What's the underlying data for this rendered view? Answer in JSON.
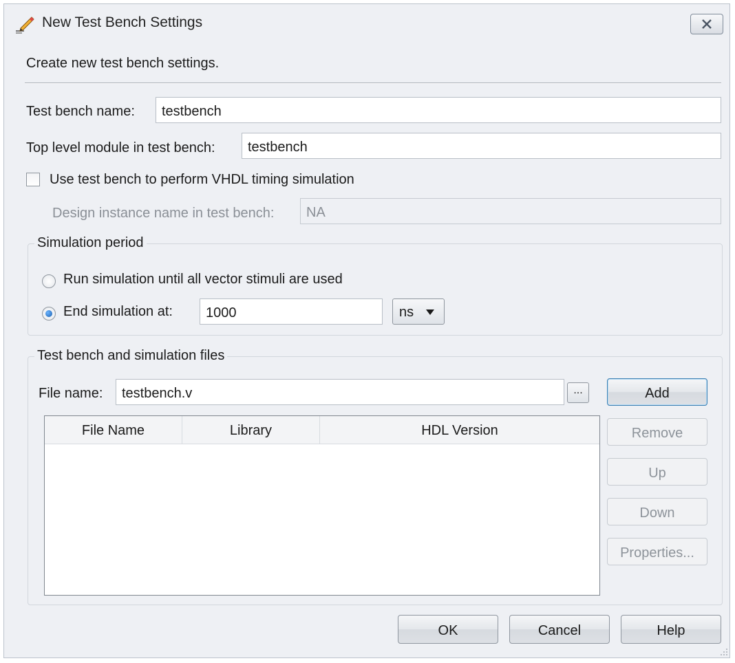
{
  "window": {
    "title": "New Test Bench Settings",
    "close_icon": "close-icon"
  },
  "intro": "Create new test bench settings.",
  "test_bench_name": {
    "label": "Test bench name:",
    "value": "testbench"
  },
  "top_level_module": {
    "label": "Top level module in test bench:",
    "value": "testbench"
  },
  "vhdl_timing": {
    "label": "Use test bench to perform VHDL timing simulation",
    "checked": false
  },
  "design_instance": {
    "label": "Design instance name in test bench:",
    "value": "NA"
  },
  "simulation_period": {
    "title": "Simulation period",
    "run_until_label": "Run simulation until all vector stimuli are used",
    "end_at_label": "End simulation at:",
    "end_at_value": "1000",
    "unit": "ns",
    "selected": "end_at"
  },
  "files_group": {
    "title": "Test bench and simulation files",
    "file_name_label": "File name:",
    "file_name_value": "testbench.v",
    "browse_label": "...",
    "columns": [
      "File Name",
      "Library",
      "HDL Version"
    ],
    "rows": []
  },
  "side_buttons": {
    "add": "Add",
    "remove": "Remove",
    "up": "Up",
    "down": "Down",
    "properties": "Properties..."
  },
  "footer_buttons": {
    "ok": "OK",
    "cancel": "Cancel",
    "help": "Help"
  }
}
